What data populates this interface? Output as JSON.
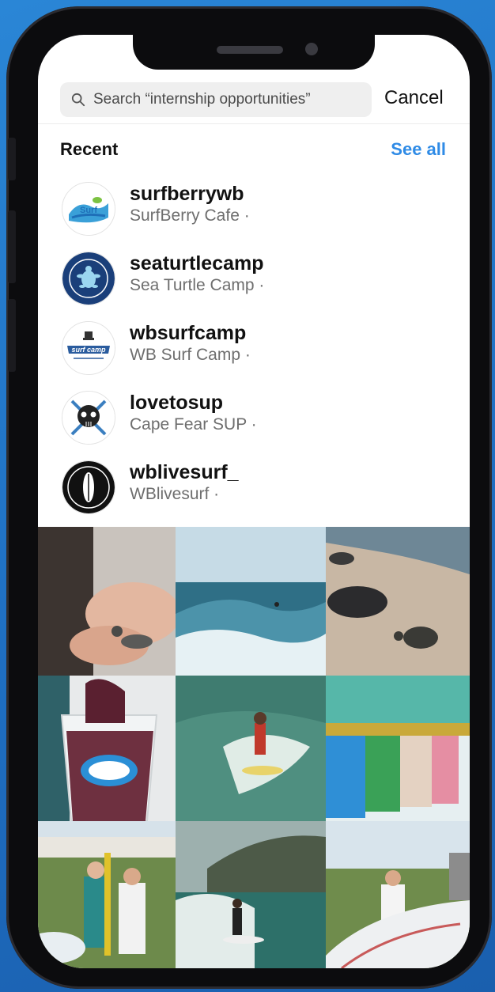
{
  "search": {
    "placeholder": "Search “internship opportunities”",
    "value": "",
    "cancel_label": "Cancel"
  },
  "recent": {
    "title": "Recent",
    "see_all_label": "See all",
    "accounts": [
      {
        "handle": "surfberrywb",
        "name": "SurfBerry Cafe ·",
        "avatar_icon": "surfberry-logo-icon"
      },
      {
        "handle": "seaturtlecamp",
        "name": "Sea Turtle Camp ·",
        "avatar_icon": "sea-turtle-camp-logo-icon"
      },
      {
        "handle": "wbsurfcamp",
        "name": "WB Surf Camp ·",
        "avatar_icon": "surf-camp-logo-icon"
      },
      {
        "handle": "lovetosup",
        "name": "Cape Fear SUP ·",
        "avatar_icon": "skull-paddles-logo-icon"
      },
      {
        "handle": "wblivesurf_",
        "name": "WBlivesurf ·",
        "avatar_icon": "surfboard-badge-logo-icon"
      }
    ]
  },
  "grid": {
    "tiles": [
      {
        "subject": "hand-holding-turtle-hatchling"
      },
      {
        "subject": "surfer-on-wave"
      },
      {
        "subject": "sea-turtle-on-beach"
      },
      {
        "subject": "acai-smoothie-cup"
      },
      {
        "subject": "surfer-riding-wave"
      },
      {
        "subject": "row-of-smoothies"
      },
      {
        "subject": "paddleboarders-group"
      },
      {
        "subject": "surfer-near-headland"
      },
      {
        "subject": "paddleboarders-on-dock"
      }
    ]
  },
  "colors": {
    "accent": "#2f8be6",
    "background": "#1f6fc2",
    "phone_frame": "#0c0c0e"
  }
}
